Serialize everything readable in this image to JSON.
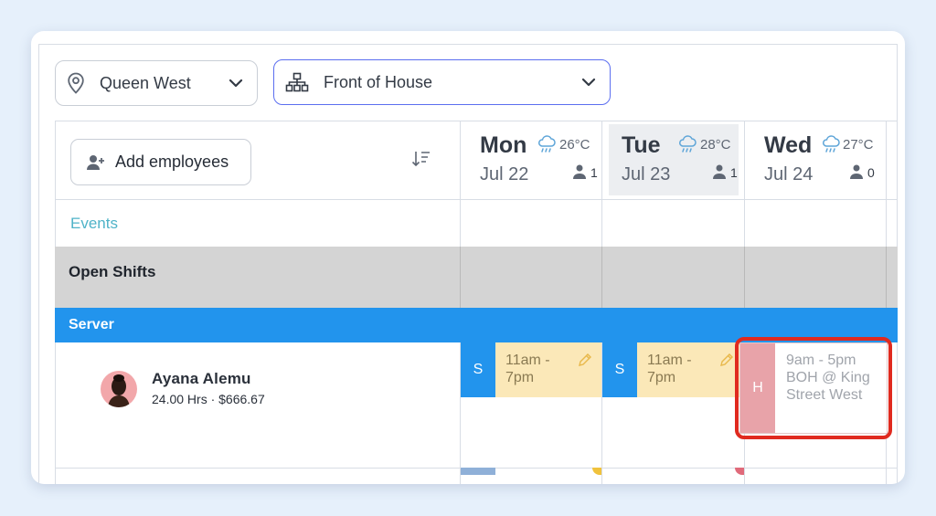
{
  "filters": {
    "location": "Queen West",
    "department": "Front of House"
  },
  "toolbar": {
    "add_employees_label": "Add employees"
  },
  "days": [
    {
      "name": "Mon",
      "temp": "26°C",
      "date": "Jul 22",
      "count": "1"
    },
    {
      "name": "Tue",
      "temp": "28°C",
      "date": "Jul 23",
      "count": "1"
    },
    {
      "name": "Wed",
      "temp": "27°C",
      "date": "Jul 24",
      "count": "0"
    }
  ],
  "rows": {
    "events_label": "Events",
    "open_shifts_label": "Open Shifts",
    "role_label": "Server"
  },
  "employee": {
    "name": "Ayana Alemu",
    "summary": "24.00 Hrs · $666.67"
  },
  "shifts": [
    {
      "tag": "S",
      "time": "11am - 7pm"
    },
    {
      "tag": "S",
      "time": "11am - 7pm"
    }
  ],
  "holiday_shift": {
    "tag": "H",
    "text": "9am - 5pm BOH @ King Street West"
  },
  "colors": {
    "accent": "#2294ed",
    "highlight": "#e02a1f",
    "shift_bg": "#fbe8b8",
    "holiday_tag": "#e8a3a9",
    "events_text": "#4fb3c8"
  }
}
